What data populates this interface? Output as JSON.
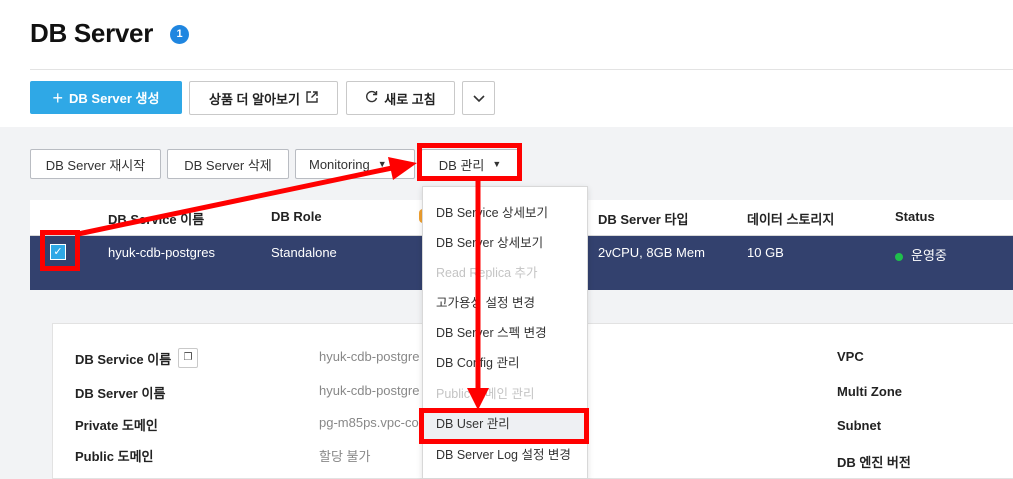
{
  "page": {
    "title": "DB Server",
    "badge": "1"
  },
  "toolbar": {
    "create_label": "DB Server 생성",
    "create_icon": "plus-icon",
    "learn_more_label": "상품 더 알아보기",
    "learn_more_icon": "external-link-icon",
    "refresh_label": "새로 고침",
    "refresh_icon": "refresh-icon",
    "more_icon": "chevron-down-icon"
  },
  "actions": {
    "restart_label": "DB Server 재시작",
    "delete_label": "DB Server 삭제",
    "monitoring_label": "Monitoring",
    "db_manage_label": "DB 관리"
  },
  "table": {
    "headers": [
      "DB Service 이름",
      "DB Role",
      "DB Server 타입",
      "데이터 스토리지",
      "Status"
    ],
    "row": {
      "service_name": "hyuk-cdb-postgres",
      "role": "Standalone",
      "server_type": "2vCPU, 8GB Mem",
      "storage": "10 GB",
      "status": "운영중"
    }
  },
  "details": {
    "labels": [
      "DB Service 이름",
      "DB Server 이름",
      "Private 도메인",
      "Public 도메인"
    ],
    "values": [
      "hyuk-cdb-postgre",
      "hyuk-cdb-postgre",
      "pg-m85ps.vpc-co",
      "할당 불가"
    ],
    "right_labels": [
      "VPC",
      "Multi Zone",
      "Subnet",
      "DB 엔진 버전"
    ]
  },
  "dropdown": {
    "items": [
      {
        "label": "DB Service 상세보기",
        "state": "enabled"
      },
      {
        "label": "DB Server 상세보기",
        "state": "enabled"
      },
      {
        "label": "Read Replica 추가",
        "state": "disabled"
      },
      {
        "label": "고가용성 설정 변경",
        "state": "enabled"
      },
      {
        "label": "DB Server 스펙 변경",
        "state": "enabled"
      },
      {
        "label": "DB Config 관리",
        "state": "enabled"
      },
      {
        "label": "Public 도메인 관리",
        "state": "disabled"
      },
      {
        "label": "DB User 관리",
        "state": "active"
      },
      {
        "label": "DB Server Log 설정 변경",
        "state": "enabled"
      }
    ]
  },
  "colors": {
    "primary": "#2fa8e6",
    "selected_row": "#33416e",
    "status_running": "#1fbf4c",
    "highlight": "#ff0000"
  }
}
